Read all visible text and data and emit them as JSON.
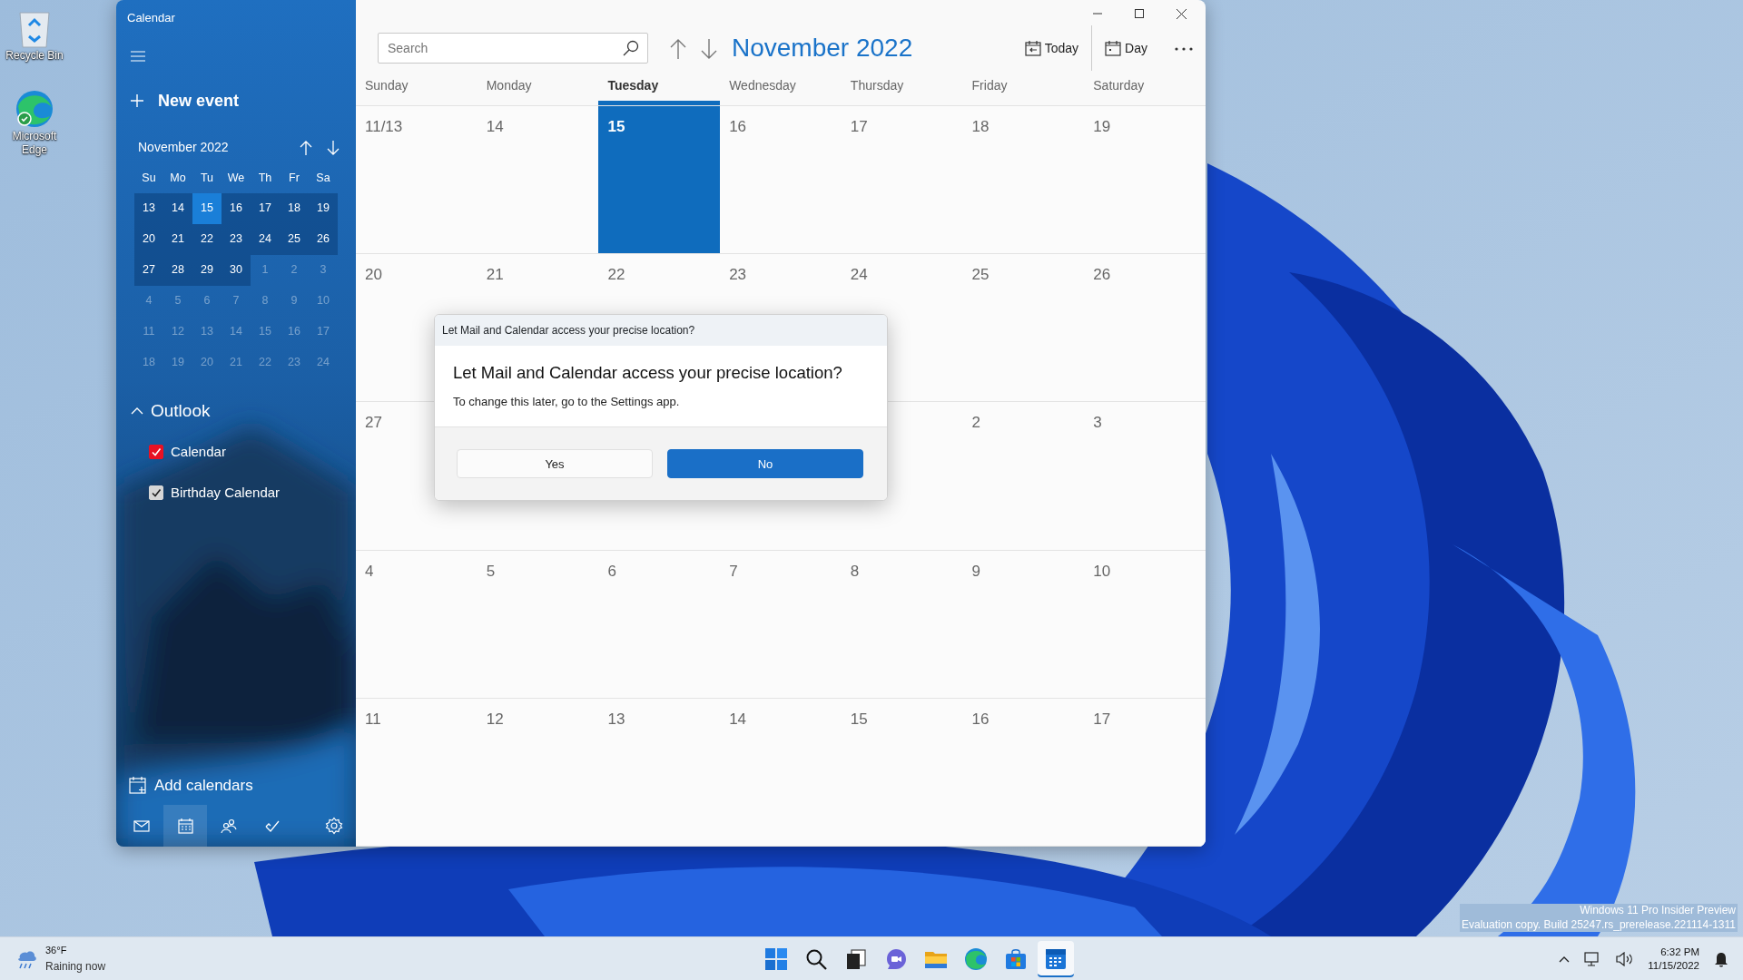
{
  "desktop_icons": [
    {
      "label": "Recycle Bin",
      "kind": "recycle"
    },
    {
      "label": "Microsoft Edge",
      "kind": "edge"
    }
  ],
  "window": {
    "title": "Calendar"
  },
  "sidebar": {
    "new_event": "New event",
    "mini_calendar": {
      "month": "November 2022",
      "weekdays": [
        "Su",
        "Mo",
        "Tu",
        "We",
        "Th",
        "Fr",
        "Sa"
      ],
      "weeks": [
        [
          {
            "d": "13",
            "highlighted": true,
            "selected": false
          },
          {
            "d": "14",
            "highlighted": true,
            "selected": false
          },
          {
            "d": "15",
            "highlighted": true,
            "selected": true
          },
          {
            "d": "16",
            "highlighted": true,
            "selected": false
          },
          {
            "d": "17",
            "highlighted": true,
            "selected": false
          },
          {
            "d": "18",
            "highlighted": true,
            "selected": false
          },
          {
            "d": "19",
            "highlighted": true,
            "selected": false
          }
        ],
        [
          {
            "d": "20",
            "highlighted": true,
            "selected": false
          },
          {
            "d": "21",
            "highlighted": true,
            "selected": false
          },
          {
            "d": "22",
            "highlighted": true,
            "selected": false
          },
          {
            "d": "23",
            "highlighted": true,
            "selected": false
          },
          {
            "d": "24",
            "highlighted": true,
            "selected": false
          },
          {
            "d": "25",
            "highlighted": true,
            "selected": false
          },
          {
            "d": "26",
            "highlighted": true,
            "selected": false
          }
        ],
        [
          {
            "d": "27",
            "highlighted": true,
            "selected": false
          },
          {
            "d": "28",
            "highlighted": true,
            "selected": false
          },
          {
            "d": "29",
            "highlighted": true,
            "selected": false
          },
          {
            "d": "30",
            "highlighted": true,
            "selected": false
          },
          {
            "d": "1",
            "highlighted": false,
            "selected": false
          },
          {
            "d": "2",
            "highlighted": false,
            "selected": false
          },
          {
            "d": "3",
            "highlighted": false,
            "selected": false
          }
        ],
        [
          {
            "d": "4",
            "highlighted": false,
            "selected": false
          },
          {
            "d": "5",
            "highlighted": false,
            "selected": false
          },
          {
            "d": "6",
            "highlighted": false,
            "selected": false
          },
          {
            "d": "7",
            "highlighted": false,
            "selected": false
          },
          {
            "d": "8",
            "highlighted": false,
            "selected": false
          },
          {
            "d": "9",
            "highlighted": false,
            "selected": false
          },
          {
            "d": "10",
            "highlighted": false,
            "selected": false
          }
        ],
        [
          {
            "d": "11",
            "highlighted": false,
            "selected": false
          },
          {
            "d": "12",
            "highlighted": false,
            "selected": false
          },
          {
            "d": "13",
            "highlighted": false,
            "selected": false
          },
          {
            "d": "14",
            "highlighted": false,
            "selected": false
          },
          {
            "d": "15",
            "highlighted": false,
            "selected": false
          },
          {
            "d": "16",
            "highlighted": false,
            "selected": false
          },
          {
            "d": "17",
            "highlighted": false,
            "selected": false
          }
        ],
        [
          {
            "d": "18",
            "highlighted": false,
            "selected": false
          },
          {
            "d": "19",
            "highlighted": false,
            "selected": false
          },
          {
            "d": "20",
            "highlighted": false,
            "selected": false
          },
          {
            "d": "21",
            "highlighted": false,
            "selected": false
          },
          {
            "d": "22",
            "highlighted": false,
            "selected": false
          },
          {
            "d": "23",
            "highlighted": false,
            "selected": false
          },
          {
            "d": "24",
            "highlighted": false,
            "selected": false
          }
        ]
      ]
    },
    "account": {
      "name": "Outlook",
      "expanded": true,
      "calendars": [
        {
          "name": "Calendar",
          "checked": true,
          "color": "#e81123"
        },
        {
          "name": "Birthday Calendar",
          "checked": true,
          "color": "#d6d6d6"
        }
      ]
    },
    "add_calendars": "Add calendars",
    "bottom_nav": [
      {
        "kind": "mail",
        "selected": false
      },
      {
        "kind": "calendar",
        "selected": true
      },
      {
        "kind": "people",
        "selected": false
      },
      {
        "kind": "todo",
        "selected": false
      },
      {
        "kind": "settings",
        "selected": false
      }
    ]
  },
  "toolbar": {
    "search": {
      "placeholder": "Search"
    },
    "month": "November 2022",
    "buttons": [
      {
        "kind": "today",
        "label": "Today"
      },
      {
        "kind": "day",
        "label": "Day"
      }
    ]
  },
  "day_headers": [
    {
      "label": "Sunday",
      "selected": false
    },
    {
      "label": "Monday",
      "selected": false
    },
    {
      "label": "Tuesday",
      "selected": true
    },
    {
      "label": "Wednesday",
      "selected": false
    },
    {
      "label": "Thursday",
      "selected": false
    },
    {
      "label": "Friday",
      "selected": false
    },
    {
      "label": "Saturday",
      "selected": false
    }
  ],
  "weeks": [
    [
      {
        "day": "11/13",
        "selected": false
      },
      {
        "day": "14",
        "selected": false
      },
      {
        "day": "15",
        "selected": true
      },
      {
        "day": "16",
        "selected": false
      },
      {
        "day": "17",
        "selected": false
      },
      {
        "day": "18",
        "selected": false
      },
      {
        "day": "19",
        "selected": false
      }
    ],
    [
      {
        "day": "20",
        "selected": false
      },
      {
        "day": "21",
        "selected": false
      },
      {
        "day": "22",
        "selected": false
      },
      {
        "day": "23",
        "selected": false
      },
      {
        "day": "24",
        "selected": false
      },
      {
        "day": "25",
        "selected": false
      },
      {
        "day": "26",
        "selected": false
      }
    ],
    [
      {
        "day": "27",
        "selected": false
      },
      {
        "selected": false
      },
      {
        "selected": false
      },
      {
        "selected": false
      },
      {
        "selected": false
      },
      {
        "day": "2",
        "selected": false
      },
      {
        "day": "3",
        "selected": false
      }
    ],
    [
      {
        "day": "4",
        "selected": false
      },
      {
        "day": "5",
        "selected": false
      },
      {
        "day": "6",
        "selected": false
      },
      {
        "day": "7",
        "selected": false
      },
      {
        "day": "8",
        "selected": false
      },
      {
        "day": "9",
        "selected": false
      },
      {
        "day": "10",
        "selected": false
      }
    ],
    [
      {
        "day": "11",
        "selected": false
      },
      {
        "day": "12",
        "selected": false
      },
      {
        "day": "13",
        "selected": false
      },
      {
        "day": "14",
        "selected": false
      },
      {
        "day": "15",
        "selected": false
      },
      {
        "day": "16",
        "selected": false
      },
      {
        "day": "17",
        "selected": false
      }
    ]
  ],
  "dialog": {
    "caption": "Let Mail and Calendar access your precise location?",
    "heading": "Let Mail and Calendar access your precise location?",
    "message": "To change this later, go to the Settings app.",
    "buttons": [
      {
        "label": "Yes",
        "primary": false
      },
      {
        "label": "No",
        "primary": true
      }
    ]
  },
  "build_info": [
    "Windows 11 Pro Insider Preview",
    "Evaluation copy. Build 25247.rs_prerelease.221114-1311"
  ],
  "taskbar": {
    "weather": {
      "temperature": "36°F",
      "condition": "Raining now"
    },
    "apps": [
      {
        "kind": "start",
        "active": false
      },
      {
        "kind": "search",
        "active": false
      },
      {
        "kind": "taskview",
        "active": false
      },
      {
        "kind": "chat",
        "active": false
      },
      {
        "kind": "explorer",
        "active": false
      },
      {
        "kind": "edge",
        "active": false
      },
      {
        "kind": "store",
        "active": false
      },
      {
        "kind": "calendar",
        "active": true
      }
    ],
    "clock": {
      "time": "6:32 PM",
      "date": "11/15/2022"
    }
  }
}
